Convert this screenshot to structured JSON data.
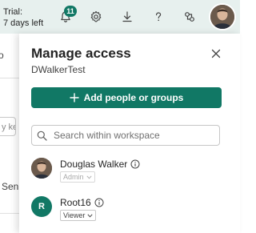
{
  "topbar": {
    "trial_line1": "Trial:",
    "trial_line2": "7 days left",
    "notification_count": "11",
    "accent_color": "#117865"
  },
  "background": {
    "fragment_top": "o",
    "search_fragment": "y ke",
    "fragment_mid": "Sen"
  },
  "panel": {
    "title": "Manage access",
    "subtitle": "DWalkerTest",
    "add_button_label": "Add people or groups",
    "search_placeholder": "Search within workspace",
    "people": [
      {
        "name": "Douglas Walker",
        "role": "Admin",
        "role_enabled": false,
        "avatar": "photo"
      },
      {
        "name": "Root16",
        "role": "Viewer",
        "role_enabled": true,
        "avatar": "R"
      }
    ]
  },
  "icons": [
    "bell-icon",
    "gear-icon",
    "download-icon",
    "help-icon",
    "share-icon",
    "close-icon",
    "plus-icon",
    "search-icon",
    "info-icon",
    "chevron-down-icon"
  ]
}
